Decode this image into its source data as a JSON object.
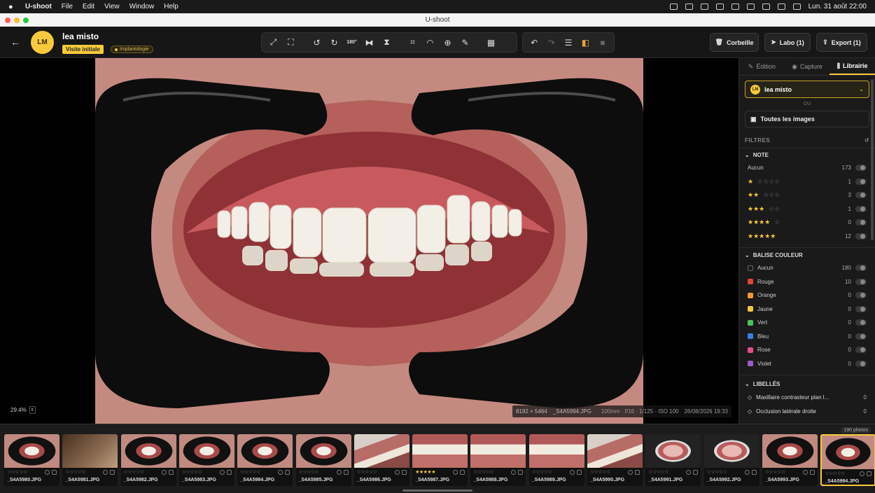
{
  "menubar": {
    "app": "U-shoot",
    "items": [
      "File",
      "Edit",
      "View",
      "Window",
      "Help"
    ],
    "datetime": "Lun. 31 août  22:00"
  },
  "window": {
    "title": "U-shoot"
  },
  "patient": {
    "initials": "LM",
    "name": "lea misto",
    "visit": "Visite initiale",
    "tag": "Implantologie"
  },
  "toolbar": {
    "btn180": "180°"
  },
  "header_buttons": {
    "trash": "Corbeille",
    "labo": "Labo (1)",
    "export": "Export (1)"
  },
  "viewer": {
    "zoom": "29.4%",
    "dimensions": "8192 × 5464",
    "filename": "_S4A5994.JPG",
    "exif": "100mm · f/16 · 1/125 · ISO 100",
    "date": "26/08/2026 19:33"
  },
  "panel": {
    "tabs": [
      "Édition",
      "Capture",
      "Librairie"
    ],
    "patient_select": "lea misto",
    "or": "OU",
    "all_images": "Toutes les images",
    "filters_title": "FILTRES",
    "note_title": "NOTE",
    "note_rows": [
      {
        "label": "Aucun",
        "count": "173",
        "stars": 0
      },
      {
        "count": "1",
        "stars": 1
      },
      {
        "count": "3",
        "stars": 2
      },
      {
        "count": "1",
        "stars": 3
      },
      {
        "count": "0",
        "stars": 4
      },
      {
        "count": "12",
        "stars": 5
      }
    ],
    "color_title": "BALISE COULEUR",
    "color_rows": [
      {
        "label": "Aucun",
        "count": "180",
        "color": "#1a1a1a"
      },
      {
        "label": "Rouge",
        "count": "10",
        "color": "#e0443a"
      },
      {
        "label": "Orange",
        "count": "0",
        "color": "#f09a2b"
      },
      {
        "label": "Jaune",
        "count": "0",
        "color": "#f2c73a"
      },
      {
        "label": "Vert",
        "count": "0",
        "color": "#4cc45a"
      },
      {
        "label": "Bleu",
        "count": "0",
        "color": "#3d7fe0"
      },
      {
        "label": "Rose",
        "count": "0",
        "color": "#e84b8a"
      },
      {
        "label": "Violet",
        "count": "0",
        "color": "#9a5ad0"
      }
    ],
    "labels_title": "LIBELLÉS",
    "label_rows": [
      {
        "label": "Maxillaire contrasteur plan l...",
        "count": "0"
      },
      {
        "label": "Occlusion latérale droite",
        "count": "0"
      }
    ]
  },
  "filmstrip": {
    "count_label": "190 photos",
    "thumbs": [
      {
        "file": "_S4A5980.JPG",
        "kind": "retractor",
        "stars": 0
      },
      {
        "file": "_S4A5981.JPG",
        "kind": "blank",
        "stars": 0
      },
      {
        "file": "_S4A5982.JPG",
        "kind": "retractor",
        "stars": 0
      },
      {
        "file": "_S4A5983.JPG",
        "kind": "retractor",
        "stars": 0
      },
      {
        "file": "_S4A5984.JPG",
        "kind": "retractor",
        "stars": 0
      },
      {
        "file": "_S4A5985.JPG",
        "kind": "retractor",
        "stars": 0
      },
      {
        "file": "_S4A5986.JPG",
        "kind": "side",
        "stars": 0
      },
      {
        "file": "_S4A5987.JPG",
        "kind": "teeth",
        "stars": 5
      },
      {
        "file": "_S4A5988.JPG",
        "kind": "teeth",
        "stars": 0
      },
      {
        "file": "_S4A5989.JPG",
        "kind": "teeth",
        "stars": 0
      },
      {
        "file": "_S4A5990.JPG",
        "kind": "side",
        "stars": 0
      },
      {
        "file": "_S4A5991.JPG",
        "kind": "mirror",
        "stars": 0
      },
      {
        "file": "_S4A5992.JPG",
        "kind": "mirror",
        "stars": 0
      },
      {
        "file": "_S4A5993.JPG",
        "kind": "retractor",
        "stars": 0
      },
      {
        "file": "_S4A5994.JPG",
        "kind": "retractor",
        "stars": 0,
        "selected": true
      }
    ]
  }
}
